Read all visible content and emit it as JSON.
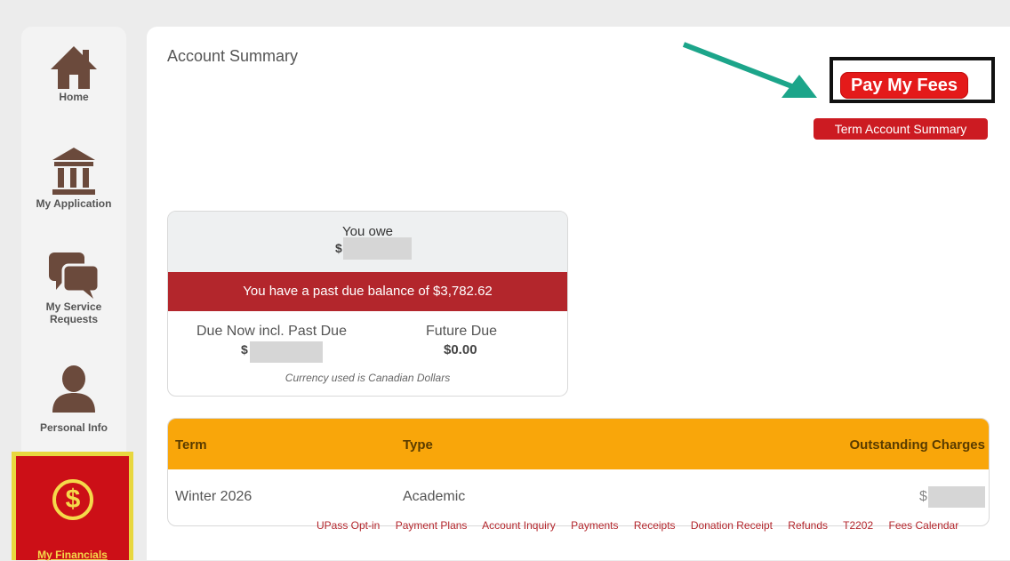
{
  "sidebar": {
    "items": [
      {
        "label": "Home",
        "icon": "home-icon"
      },
      {
        "label": "My Application",
        "icon": "bank-icon"
      },
      {
        "label": "My Service Requests",
        "icon": "chat-icon"
      },
      {
        "label": "Personal Info",
        "icon": "person-icon"
      },
      {
        "label": "My Financials",
        "icon": "dollar-icon",
        "active": true
      }
    ]
  },
  "main": {
    "title": "Account Summary",
    "pay_button": "Pay My Fees",
    "term_button": "Term Account Summary",
    "card": {
      "you_owe_label": "You owe",
      "dollar_sign": "$",
      "past_due_message": "You have a past due balance of $3,782.62",
      "due_now_label": "Due Now incl. Past Due",
      "future_due_label": "Future Due",
      "future_due_value": "$0.00",
      "currency_note": "Currency used is Canadian Dollars"
    },
    "charges_table": {
      "columns": [
        "Term",
        "Type",
        "Outstanding Charges"
      ],
      "rows": [
        {
          "term": "Winter 2026",
          "type": "Academic",
          "charges": "$"
        }
      ]
    },
    "footer_links": [
      "UPass Opt-in",
      "Payment Plans",
      "Account Inquiry",
      "Payments",
      "Receipts",
      "Donation Receipt",
      "Refunds",
      "T2202",
      "Fees Calendar"
    ]
  },
  "colors": {
    "brand_red": "#cc0f17",
    "pay_red": "#e41a1a",
    "past_due_red": "#b3262c",
    "table_header_orange": "#f9a60a",
    "active_highlight_yellow": "#e8d73f",
    "arrow_teal": "#1ca58a"
  }
}
